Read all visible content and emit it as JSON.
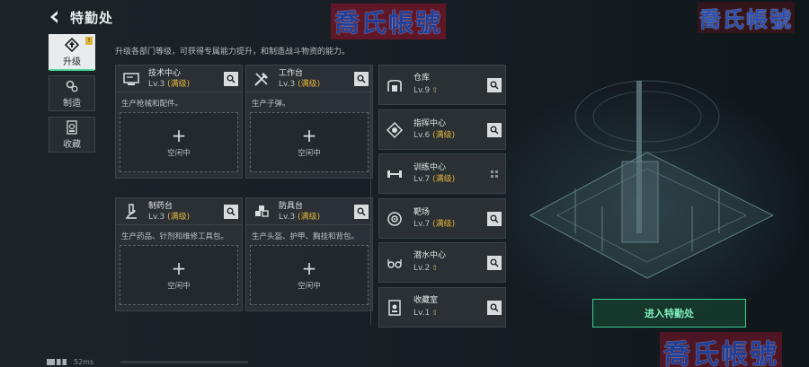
{
  "header": {
    "title": "特勤处"
  },
  "watermark": {
    "text": "喬氏帳號"
  },
  "nav": [
    {
      "label": "升级",
      "icon": "upgrade-icon",
      "badge": "!"
    },
    {
      "label": "制造",
      "icon": "gears-icon"
    },
    {
      "label": "收藏",
      "icon": "collection-icon"
    }
  ],
  "description": "升级各部门等级，可获得专属能力提升，和制造战斗物资的能力。",
  "cards": [
    {
      "name": "技术中心",
      "level": "Lv.3",
      "max": "(满级)",
      "info": "生产枪械和配件。",
      "slot_label": "空闲中",
      "icon": "monitor-icon"
    },
    {
      "name": "工作台",
      "level": "Lv.3",
      "max": "(满级)",
      "info": "生产子弹。",
      "slot_label": "空闲中",
      "icon": "tools-icon"
    },
    {
      "name": "制药台",
      "level": "Lv.3",
      "max": "(满级)",
      "info": "生产药品、针剂和维修工具包。",
      "slot_label": "空闲中",
      "icon": "microscope-icon"
    },
    {
      "name": "防具台",
      "level": "Lv.3",
      "max": "(满级)",
      "info": "生产头盔、护甲、胸挂和背包。",
      "slot_label": "空闲中",
      "icon": "armor-icon"
    }
  ],
  "rows": [
    {
      "name": "仓库",
      "level": "Lv.9",
      "max": "",
      "icon": "warehouse-icon"
    },
    {
      "name": "指挥中心",
      "level": "Lv.6",
      "max": "(满级)",
      "icon": "command-icon"
    },
    {
      "name": "训练中心",
      "level": "Lv.7",
      "max": "(满级)",
      "icon": "dumbbell-icon"
    },
    {
      "name": "靶场",
      "level": "Lv.7",
      "max": "(满级)",
      "icon": "target-icon"
    },
    {
      "name": "潜水中心",
      "level": "Lv.2",
      "max": "",
      "icon": "diving-icon"
    },
    {
      "name": "收藏室",
      "level": "Lv.1",
      "max": "",
      "icon": "display-case-icon"
    }
  ],
  "enter_button": "进入特勤处",
  "status": {
    "ping": "52ms"
  },
  "plus": "+"
}
